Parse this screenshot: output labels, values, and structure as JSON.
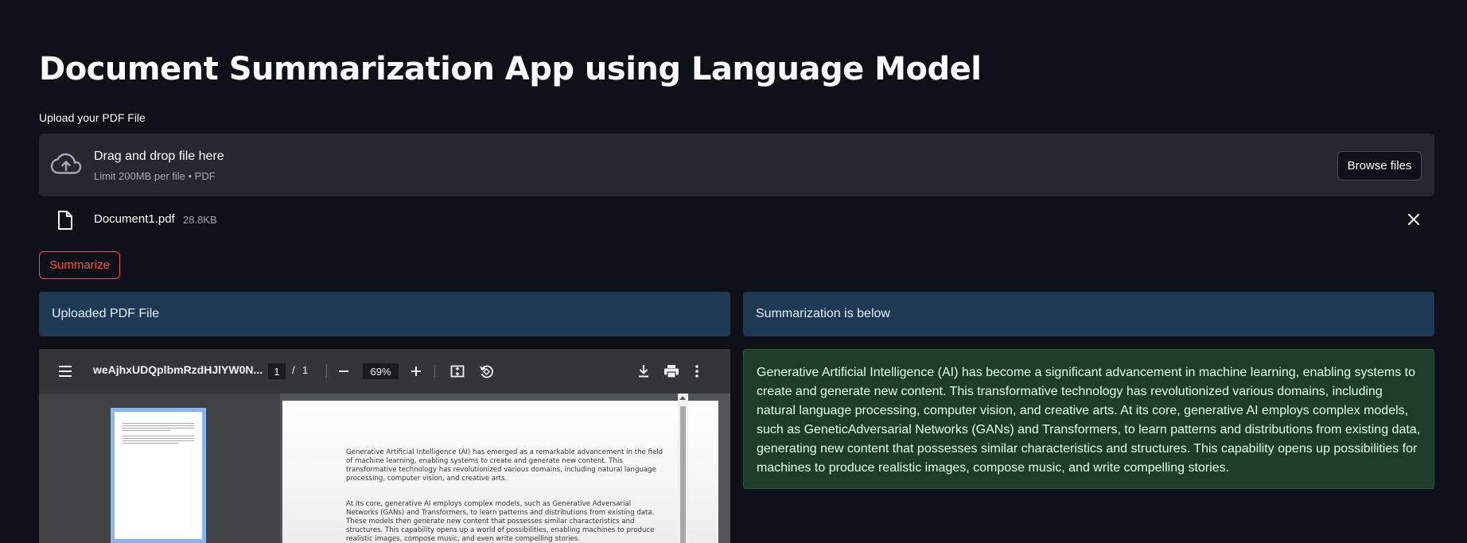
{
  "title": "Document Summarization App using Language Model",
  "uploader": {
    "label": "Upload your PDF File",
    "drag_text": "Drag and drop file here",
    "limit_text": "Limit 200MB per file • PDF",
    "browse_label": "Browse files",
    "file": {
      "name": "Document1.pdf",
      "size": "28.8KB"
    }
  },
  "summarize_label": "Summarize",
  "left_panel": {
    "header": "Uploaded PDF File"
  },
  "right_panel": {
    "header": "Summarization is below"
  },
  "pdf_viewer": {
    "filename": "weAjhxUDQplbmRzdHJlYW0N...",
    "current_page": "1",
    "separator": "/",
    "total_pages": "1",
    "zoom": "69%",
    "paragraph1": "Generative Artificial Intelligence (AI) has emerged as a remarkable advancement in the field of machine learning, enabling systems to create and generate new content. This transformative technology has revolutionized various domains, including natural language processing, computer vision, and creative arts.",
    "paragraph2": "At its core, generative AI employs complex models, such as Generative Adversarial Networks (GANs) and Transformers, to learn patterns and distributions from existing data. These models then generate new content that possesses similar characteristics and structures. This capability opens up a world of possibilities, enabling machines to produce realistic images, compose music, and even write compelling stories."
  },
  "summary": "Generative Artificial Intelligence (AI) has become a significant advancement in machine learning, enabling systems to create and generate new content. This transformative technology has revolutionized various domains, including natural language processing, computer vision, and creative arts. At its core, generative AI employs complex models, such as GeneticAdversarial Networks (GANs) and Transformers, to learn patterns and distributions from existing data, generating new content that possesses similar characteristics and structures. This capability opens up possibilities for machines to produce realistic images, compose music, and write compelling stories.",
  "colors": {
    "background": "#0e1117",
    "accent": "#ff4b4b",
    "info": "#1f3954",
    "success": "#1d3d2a"
  }
}
